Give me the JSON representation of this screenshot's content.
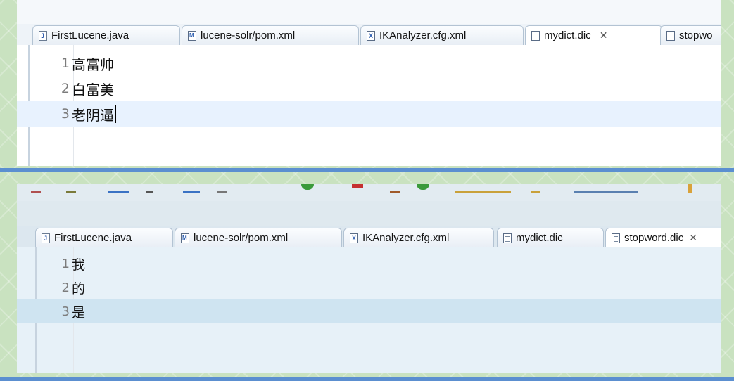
{
  "top_editor": {
    "tabs": [
      {
        "label": "FirstLucene.java",
        "icon": "java-file-icon"
      },
      {
        "label": "lucene-solr/pom.xml",
        "icon": "maven-pom-icon"
      },
      {
        "label": "IKAnalyzer.cfg.xml",
        "icon": "xml-file-icon"
      },
      {
        "label": "mydict.dic",
        "icon": "text-file-icon",
        "close": "✕"
      },
      {
        "label": "stopwo",
        "icon": "text-file-icon"
      }
    ],
    "lines": [
      {
        "num": "1",
        "text": "高富帅"
      },
      {
        "num": "2",
        "text": "白富美"
      },
      {
        "num": "3",
        "text": "老阴逼"
      }
    ]
  },
  "bottom_editor": {
    "tabs": [
      {
        "label": "FirstLucene.java",
        "icon": "java-file-icon"
      },
      {
        "label": "lucene-solr/pom.xml",
        "icon": "maven-pom-icon"
      },
      {
        "label": "IKAnalyzer.cfg.xml",
        "icon": "xml-file-icon"
      },
      {
        "label": "mydict.dic",
        "icon": "text-file-icon"
      },
      {
        "label": "stopword.dic",
        "icon": "text-file-icon",
        "close": "✕"
      }
    ],
    "lines": [
      {
        "num": "1",
        "text": "我"
      },
      {
        "num": "2",
        "text": "的"
      },
      {
        "num": "3",
        "text": "是"
      }
    ]
  },
  "colors": {
    "separator": "#5b8fd0",
    "background": "#c9e2c0",
    "current_line_top": "#e8f2fe",
    "current_line_bottom": "#cfe4f1"
  }
}
